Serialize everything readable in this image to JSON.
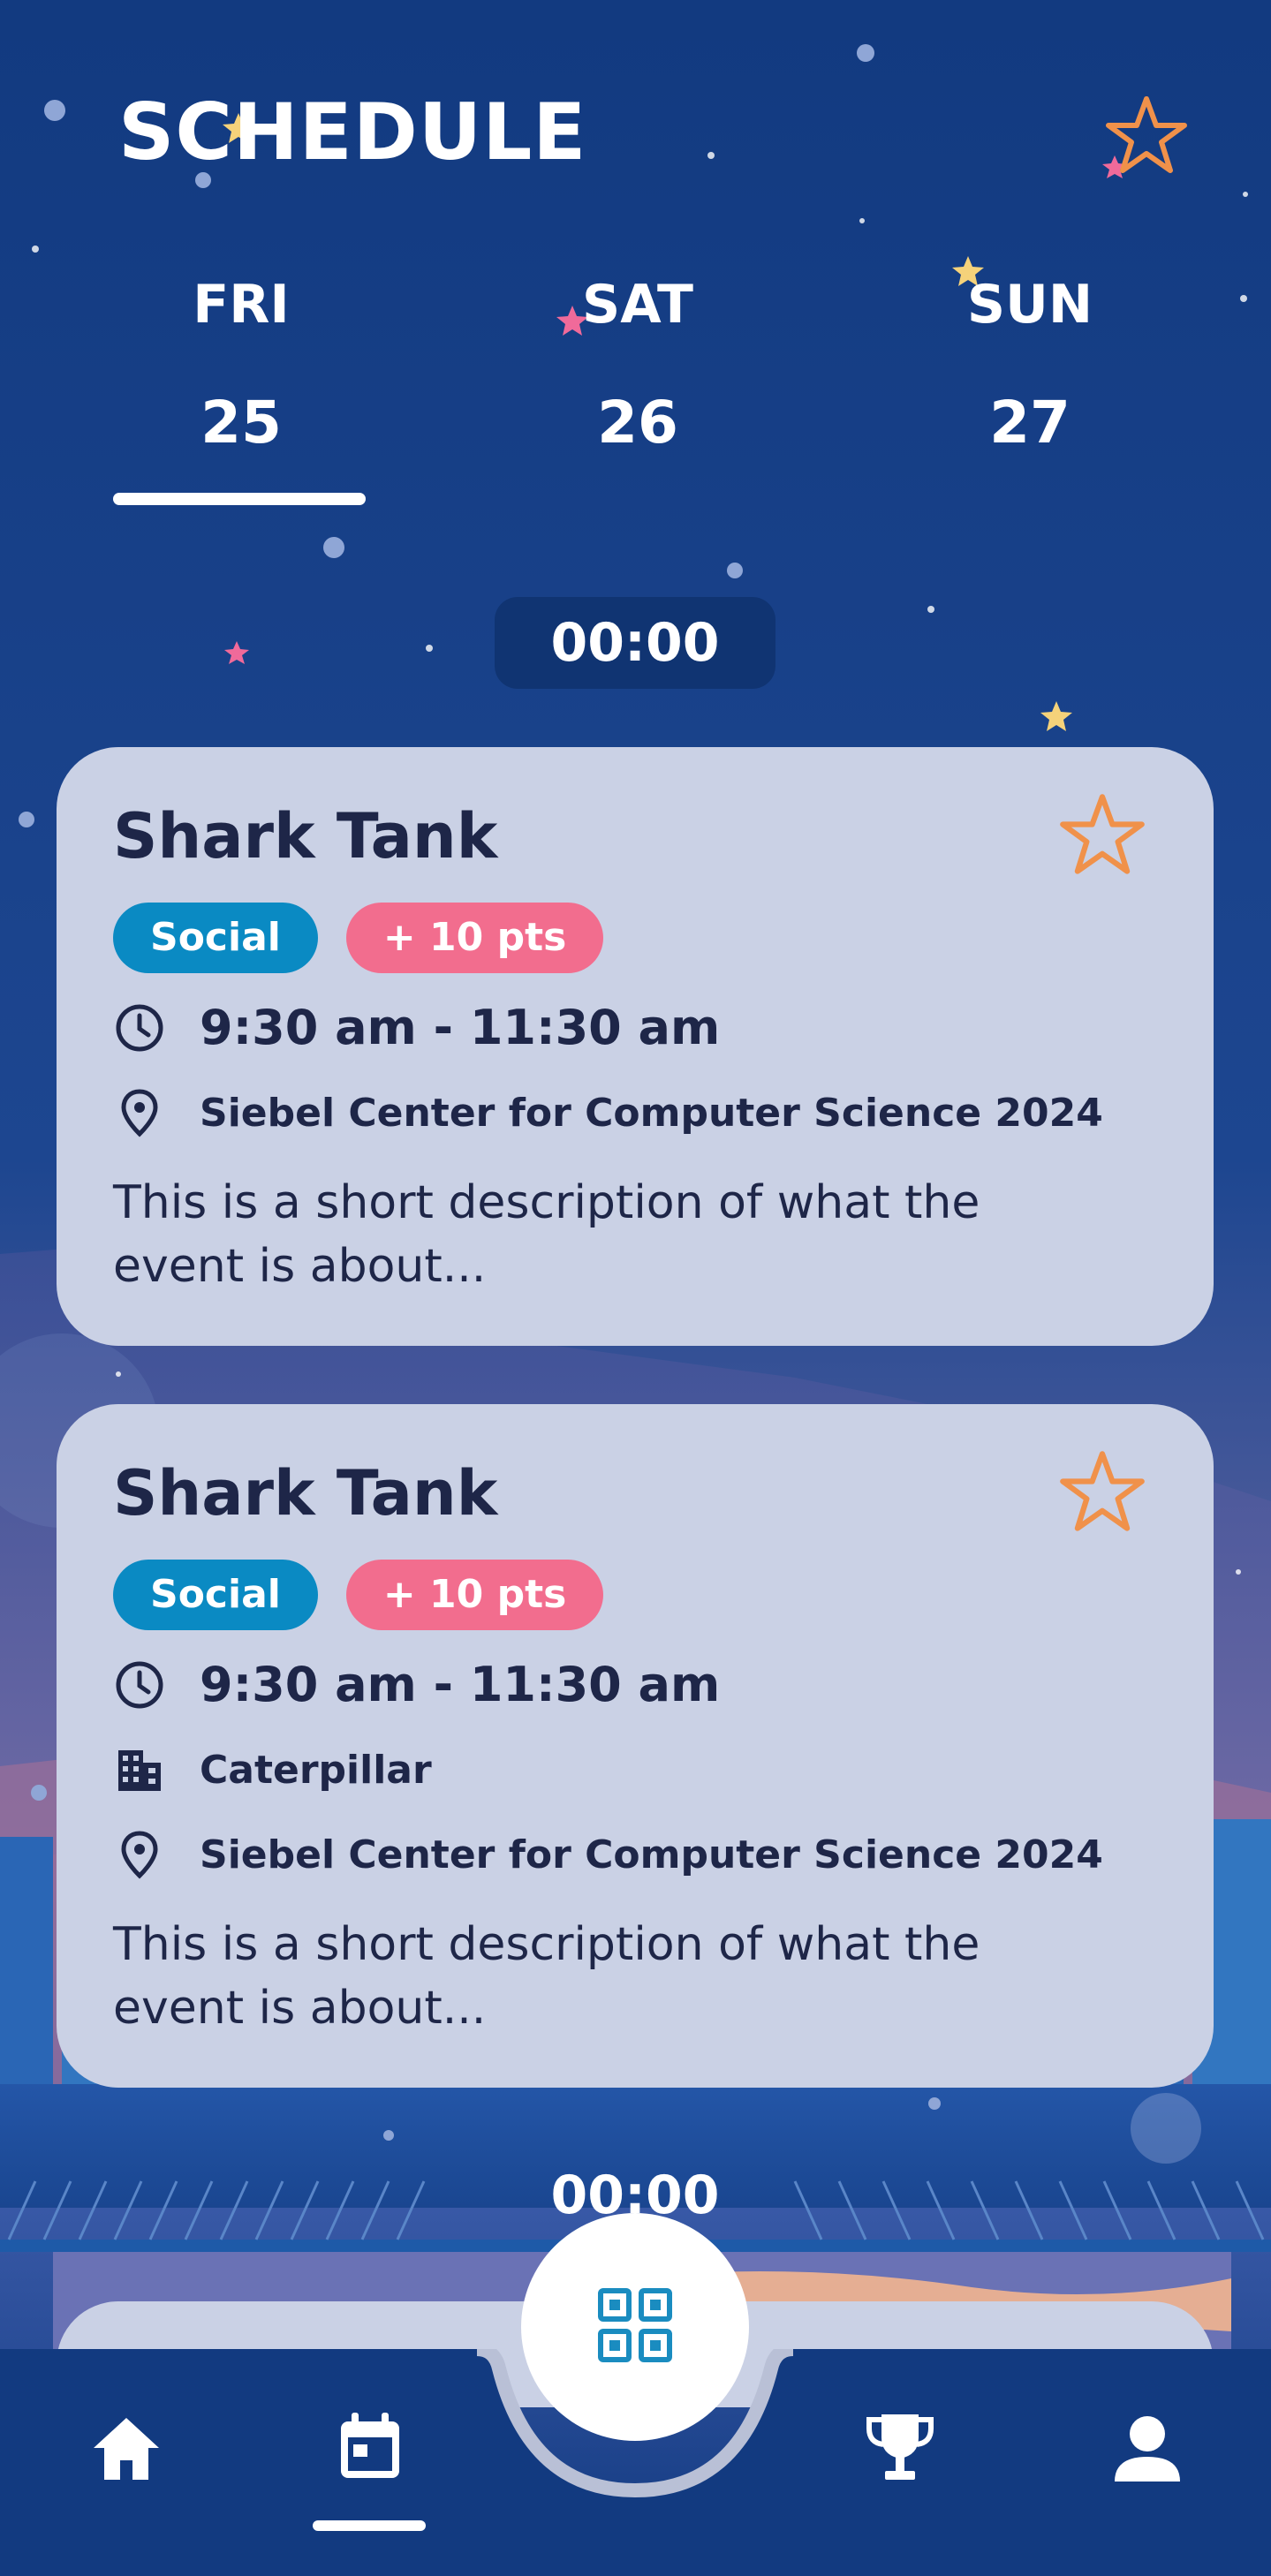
{
  "header": {
    "title": "SCHEDULE",
    "favorites_icon": "star-outline-icon"
  },
  "days": [
    {
      "dow": "FRI",
      "date": "25",
      "selected": true
    },
    {
      "dow": "SAT",
      "date": "26",
      "selected": false
    },
    {
      "dow": "SUN",
      "date": "27",
      "selected": false
    }
  ],
  "time_groups": [
    "00:00",
    "00:00"
  ],
  "events": [
    {
      "title": "Shark Tank",
      "tag": "Social",
      "points": "+ 10 pts",
      "time": "9:30 am - 11:30 am",
      "location": "Siebel Center for Computer Science 2024",
      "description_line1": "This is a short description of what the",
      "description_line2": "event is about..."
    },
    {
      "title": "Shark Tank",
      "tag": "Social",
      "points": "+ 10 pts",
      "time": "9:30 am - 11:30 am",
      "sponsor": "Caterpillar",
      "location": "Siebel Center for Computer Science 2024",
      "description_line1": "This is a short description of what the",
      "description_line2": "event is about..."
    }
  ],
  "nav": {
    "items": [
      "home-icon",
      "calendar-icon",
      "qr-code-icon",
      "trophy-icon",
      "profile-icon"
    ],
    "active": "calendar-icon"
  },
  "colors": {
    "background": "#123a80",
    "card": "#cad1e5",
    "card_text": "#1e2648",
    "social_badge": "#0a8ac3",
    "points_badge": "#f26d8e",
    "star_accent": "#f0914a",
    "qr_accent": "#1a8cc0"
  }
}
